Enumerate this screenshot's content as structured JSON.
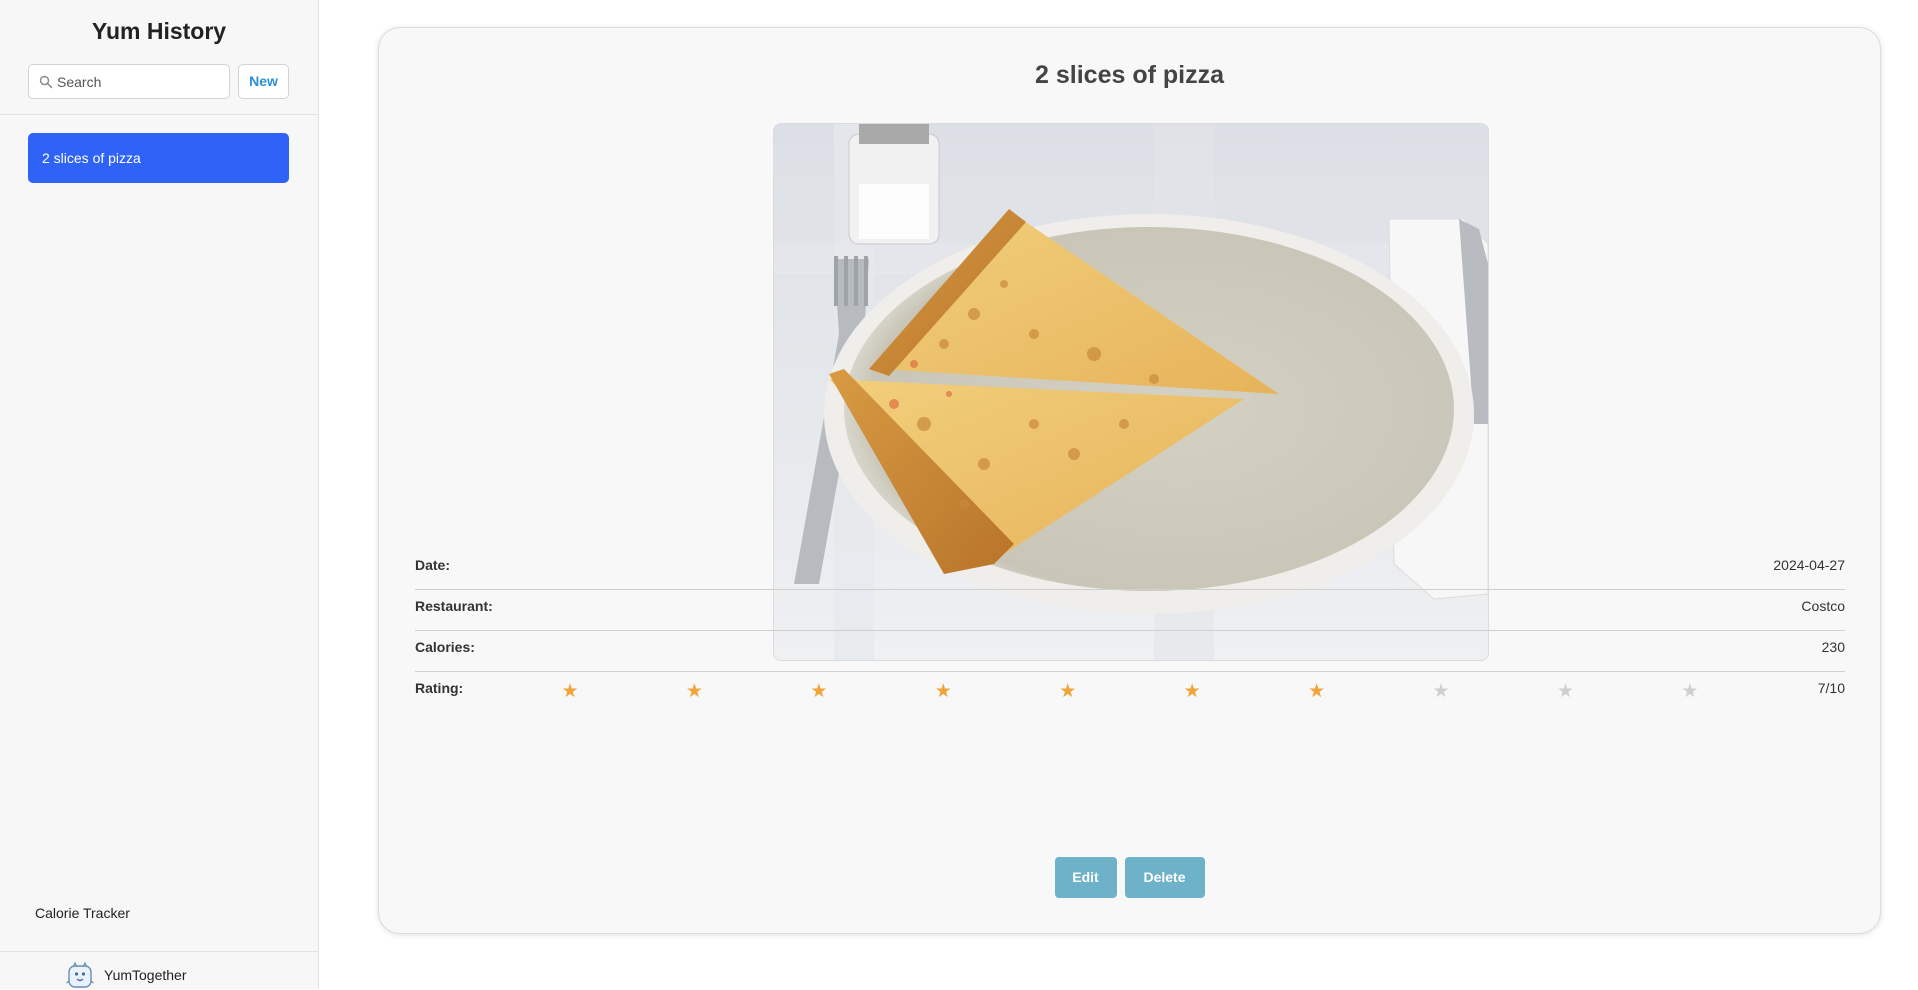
{
  "sidebar": {
    "title": "Yum History",
    "search_placeholder": "Search",
    "new_label": "New",
    "items": [
      {
        "label": "2 slices of pizza",
        "selected": true
      }
    ],
    "footer_link": "Calorie Tracker",
    "brand_name": "YumTogether",
    "icons": {
      "search": "search-icon",
      "logo": "yumtogether-logo-icon"
    }
  },
  "entry": {
    "title": "2 slices of pizza",
    "photo_alt": "2 slices of pizza",
    "fields": {
      "date_label": "Date:",
      "date_value": "2024-04-27",
      "restaurant_label": "Restaurant:",
      "restaurant_value": "Costco",
      "calories_label": "Calories:",
      "calories_value": "230",
      "rating_label": "Rating:",
      "rating_value": "7/10",
      "rating": 7,
      "rating_max": 10
    },
    "actions": {
      "edit_label": "Edit",
      "delete_label": "Delete"
    }
  },
  "colors": {
    "accent": "#2f63f7",
    "button": "#6eb2ca",
    "star_on": "#f0a43a",
    "star_off": "#cfcfcf",
    "link": "#2a8fd6"
  }
}
